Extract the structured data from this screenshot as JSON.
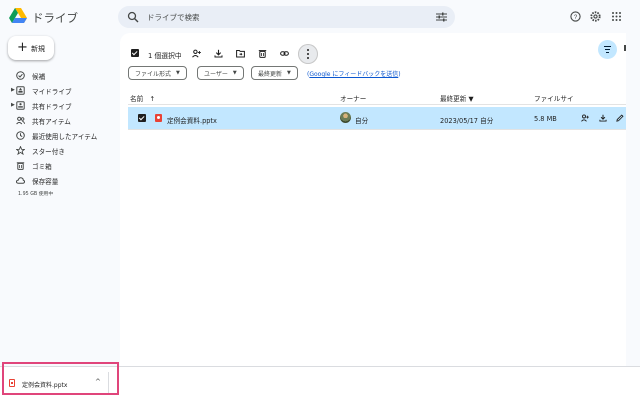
{
  "app": {
    "title": "ドライブ"
  },
  "search": {
    "placeholder": "ドライブで検索"
  },
  "header_icons": [
    "help-icon",
    "settings-icon",
    "apps-icon"
  ],
  "sidebar": {
    "new_label": "新規",
    "items": [
      {
        "label": "候補",
        "icon": "checkbox-circle-icon",
        "expandable": false
      },
      {
        "label": "マイドライブ",
        "icon": "my-drive-icon",
        "expandable": true
      },
      {
        "label": "共有ドライブ",
        "icon": "shared-drive-icon",
        "expandable": true
      },
      {
        "label": "共有アイテム",
        "icon": "people-icon",
        "expandable": false
      },
      {
        "label": "最近使用したアイテム",
        "icon": "clock-icon",
        "expandable": false
      },
      {
        "label": "スター付き",
        "icon": "star-icon",
        "expandable": false
      },
      {
        "label": "ゴミ箱",
        "icon": "trash-icon",
        "expandable": false
      },
      {
        "label": "保存容量",
        "icon": "cloud-icon",
        "expandable": false
      }
    ],
    "storage_used": "1.95 GB 使用中"
  },
  "selection": {
    "count_label": "1 個選択中",
    "actions": [
      "share-icon",
      "download-icon",
      "move-icon",
      "trash-icon",
      "link-icon",
      "more-icon"
    ]
  },
  "filters": {
    "chips": [
      "ファイル形式",
      "ユーザー",
      "最終更新"
    ],
    "feedback_prefix": "(",
    "feedback_link": "Google にフィードバックを送信",
    "feedback_suffix": ")"
  },
  "table": {
    "headers": {
      "name": "名前",
      "owner": "オーナー",
      "modified": "最終更新",
      "size": "ファイルサイ"
    },
    "sort_arrow": "↑",
    "modified_arrow": "▼",
    "rows": [
      {
        "name": "定例会資料.pptx",
        "owner": "自分",
        "modified": "2023/05/17 自分",
        "size": "5.8 MB",
        "selected": true
      }
    ]
  },
  "download_bar": {
    "file_name": "定例会資料.pptx",
    "chevron": "^"
  },
  "colors": {
    "accent": "#0b57d0",
    "selected_row": "#c2e7ff",
    "highlight": "#e0457b"
  }
}
